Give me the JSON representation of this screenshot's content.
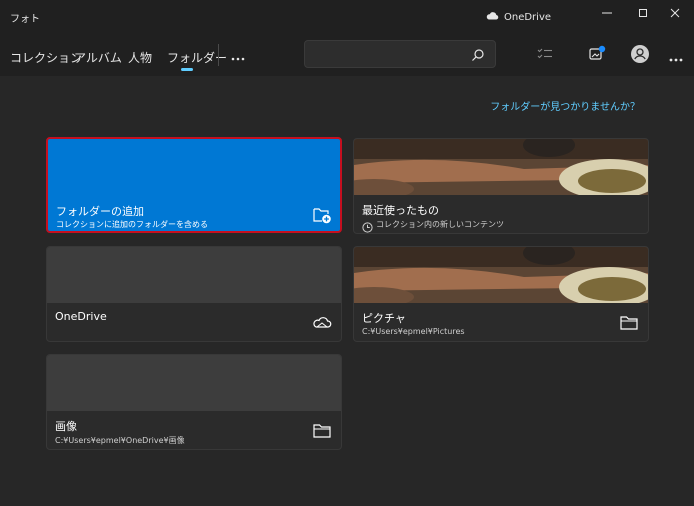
{
  "window": {
    "app_title": "フォト",
    "onedrive_label": "OneDrive",
    "controls": [
      "minimize-icon",
      "maximize-icon",
      "close-icon"
    ]
  },
  "nav": {
    "tabs": [
      {
        "label": "コレクション"
      },
      {
        "label": "アルバム"
      },
      {
        "label": "人物"
      },
      {
        "label": "フォルダー",
        "selected": true
      }
    ],
    "more_icon": "ellipsis-icon",
    "search": {
      "placeholder": "",
      "value": ""
    },
    "toolbar_icons": [
      "checklist-icon",
      "import-icon",
      "account-icon",
      "ellipsis-icon"
    ]
  },
  "main": {
    "help_link": "フォルダーが見つかりませんか？",
    "cards": [
      {
        "title": "フォルダーの追加",
        "subtitle": "コレクションに追加のフォルダーを含める",
        "icon": "folder-add-icon"
      },
      {
        "title": "最近使ったもの",
        "subtitle": "コレクション内の新しいコンテンツ",
        "icon": "clock-icon"
      },
      {
        "title": "OneDrive",
        "subtitle": "",
        "icon": "cloud-icon"
      },
      {
        "title": "ピクチャ",
        "subtitle": "C:¥Users¥epmel¥Pictures",
        "icon": "folder-icon"
      },
      {
        "title": "画像",
        "subtitle": "C:¥Users¥epmel¥OneDrive¥画像",
        "icon": "folder-icon"
      }
    ]
  },
  "colors": {
    "background": "#272727",
    "accent": "#0078d4",
    "link": "#60cdff",
    "highlight_border": "#c50f1f"
  }
}
